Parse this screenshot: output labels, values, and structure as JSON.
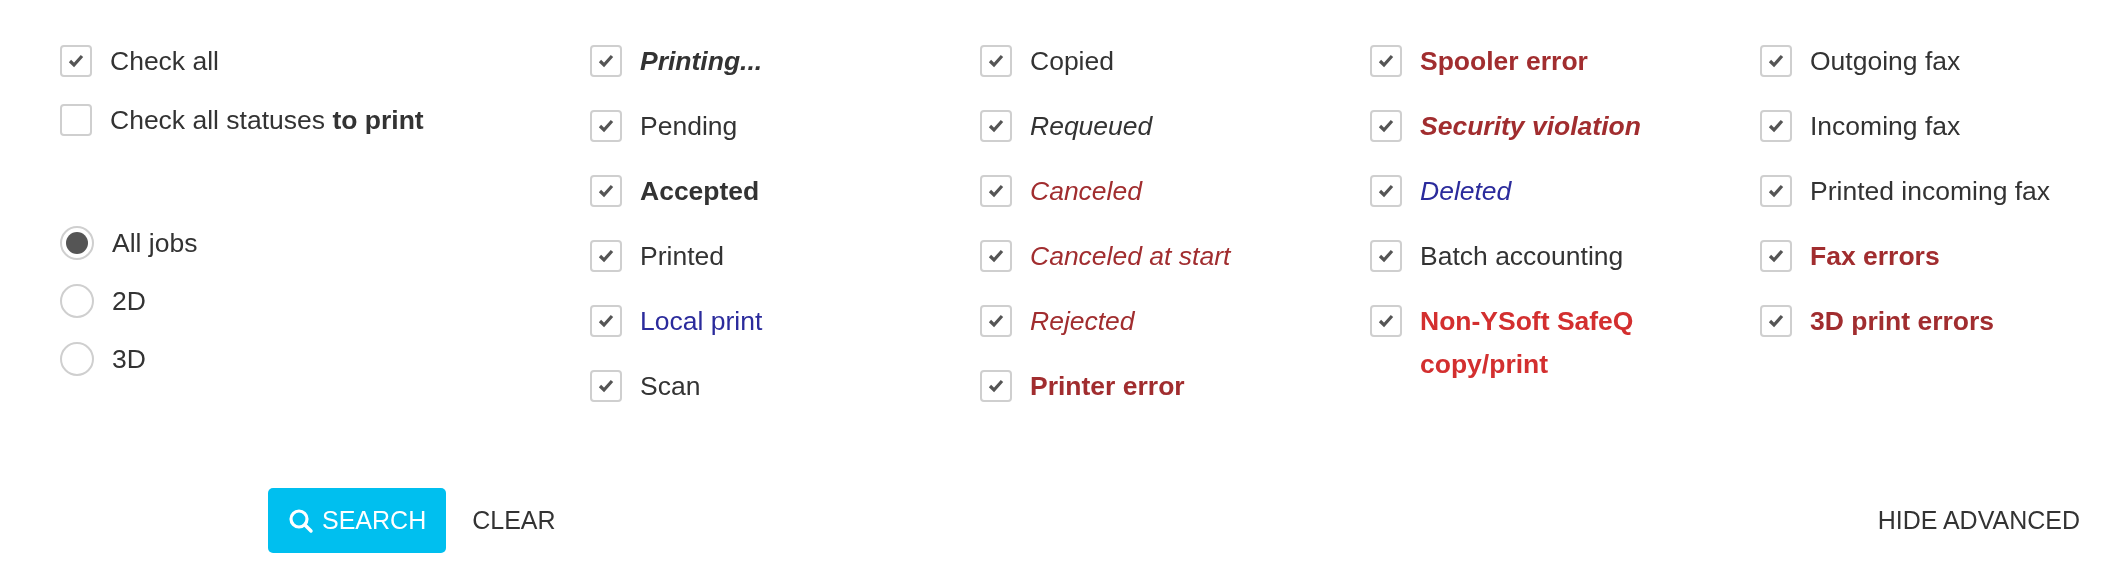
{
  "general": [
    {
      "label": "Check all",
      "checked": true
    },
    {
      "label": "Check all statuses **to print**",
      "checked": false
    }
  ],
  "job_types": [
    {
      "label": "All jobs",
      "selected": true
    },
    {
      "label": "2D",
      "selected": false
    },
    {
      "label": "3D",
      "selected": false
    }
  ],
  "status_columns": [
    [
      {
        "label": "Printing...",
        "checked": true,
        "bold": true,
        "italic": true,
        "color": "#333333"
      },
      {
        "label": "Pending",
        "checked": true,
        "bold": false,
        "italic": false,
        "color": "#333333"
      },
      {
        "label": "Accepted",
        "checked": true,
        "bold": true,
        "italic": false,
        "color": "#333333"
      },
      {
        "label": "Printed",
        "checked": true,
        "bold": false,
        "italic": false,
        "color": "#333333"
      },
      {
        "label": "Local print",
        "checked": true,
        "bold": false,
        "italic": false,
        "color": "#2b2b9c"
      },
      {
        "label": "Scan",
        "checked": true,
        "bold": false,
        "italic": false,
        "color": "#333333"
      }
    ],
    [
      {
        "label": "Copied",
        "checked": true,
        "bold": false,
        "italic": false,
        "color": "#333333"
      },
      {
        "label": "Requeued",
        "checked": true,
        "bold": false,
        "italic": true,
        "color": "#333333"
      },
      {
        "label": "Canceled",
        "checked": true,
        "bold": false,
        "italic": true,
        "color": "#a12d2f"
      },
      {
        "label": "Canceled at start",
        "checked": true,
        "bold": false,
        "italic": true,
        "color": "#a12d2f"
      },
      {
        "label": "Rejected",
        "checked": true,
        "bold": false,
        "italic": true,
        "color": "#a12d2f"
      },
      {
        "label": "Printer error",
        "checked": true,
        "bold": true,
        "italic": false,
        "color": "#a12d2f"
      }
    ],
    [
      {
        "label": "Spooler error",
        "checked": true,
        "bold": true,
        "italic": false,
        "color": "#a12d2f"
      },
      {
        "label": "Security violation",
        "checked": true,
        "bold": true,
        "italic": true,
        "color": "#a12d2f"
      },
      {
        "label": "Deleted",
        "checked": true,
        "bold": false,
        "italic": true,
        "color": "#2b2b9c"
      },
      {
        "label": "Batch accounting",
        "checked": true,
        "bold": false,
        "italic": false,
        "color": "#333333"
      },
      {
        "label": "Non-YSoft SafeQ copy/print",
        "checked": true,
        "bold": true,
        "italic": false,
        "color": "#d32f2f"
      }
    ],
    [
      {
        "label": "Outgoing fax",
        "checked": true,
        "bold": false,
        "italic": false,
        "color": "#333333"
      },
      {
        "label": "Incoming fax",
        "checked": true,
        "bold": false,
        "italic": false,
        "color": "#333333"
      },
      {
        "label": "Printed incoming fax",
        "checked": true,
        "bold": false,
        "italic": false,
        "color": "#333333"
      },
      {
        "label": "Fax errors",
        "checked": true,
        "bold": true,
        "italic": false,
        "color": "#a12d2f"
      },
      {
        "label": "3D print errors",
        "checked": true,
        "bold": true,
        "italic": false,
        "color": "#a12d2f"
      }
    ]
  ],
  "buttons": {
    "search": "SEARCH",
    "clear": "CLEAR",
    "hide_advanced": "HIDE ADVANCED"
  }
}
